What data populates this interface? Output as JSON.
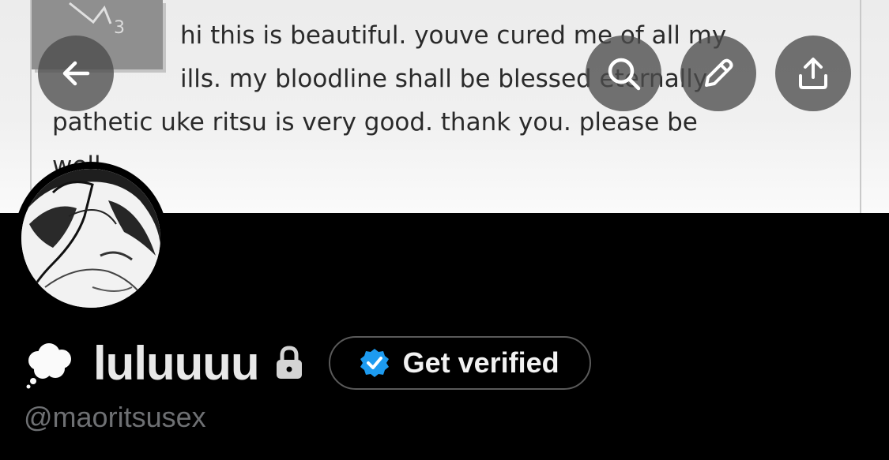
{
  "banner": {
    "line1": "hi this is beautiful. youve cured me of all my",
    "line2": "ills. my bloodline shall be blessed eternally.",
    "line3": "pathetic uke ritsu is very good. thank you. please be",
    "line4": "well."
  },
  "nav": {
    "back_icon": "arrow-left-icon",
    "search_icon": "search-icon",
    "edit_icon": "pencil-icon",
    "share_icon": "share-upload-icon"
  },
  "profile": {
    "emoji": "💭",
    "display_name": "luluuuu",
    "lock_icon": "lock-icon",
    "handle": "@maoritsusex",
    "verify_button_label": "Get verified",
    "verify_badge_color": "#1d9bf0"
  }
}
